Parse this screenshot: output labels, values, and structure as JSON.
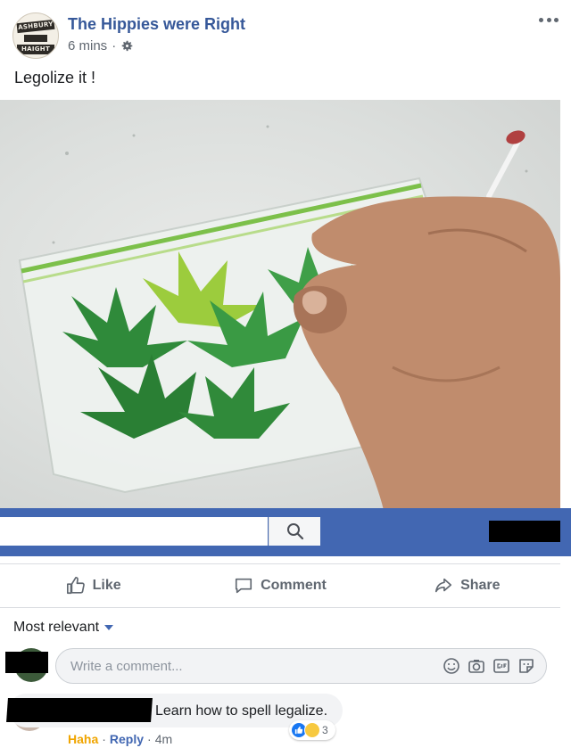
{
  "post": {
    "page_name": "The Hippies were Right",
    "timestamp": "6 mins",
    "meta_separator": "·",
    "text": "Legolize it !",
    "avatar_signs": [
      "ASHBURY",
      "HAIGHT"
    ]
  },
  "actions": {
    "like": "Like",
    "comment": "Comment",
    "share": "Share"
  },
  "comments": {
    "sort_label": "Most relevant",
    "composer_placeholder": "Write a comment...",
    "composer_icons": [
      "emoji-icon",
      "camera-icon",
      "gif-icon",
      "sticker-icon"
    ],
    "items": [
      {
        "text": "Learn how to spell legalize.",
        "reaction_label": "Haha",
        "reply_label": "Reply",
        "separator": "·",
        "time": "4m",
        "reaction_count": "3"
      }
    ]
  },
  "colors": {
    "brand_blue": "#4267b2",
    "link_blue": "#365899",
    "haha_orange": "#f0a500"
  }
}
